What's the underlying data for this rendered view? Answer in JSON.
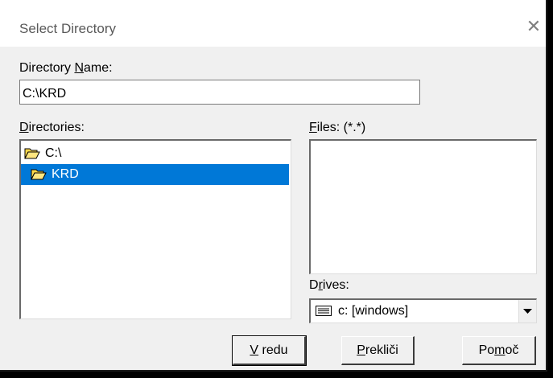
{
  "window": {
    "title": "Select Directory",
    "close_glyph": "✕"
  },
  "directory_name": {
    "label_pre": "Directory ",
    "label_u": "N",
    "label_post": "ame:",
    "value": "C:\\KRD"
  },
  "directories": {
    "label_u": "D",
    "label_post": "irectories:",
    "items": [
      {
        "label": "C:\\",
        "icon": "open-folder-icon",
        "selected": false
      },
      {
        "label": "KRD",
        "icon": "open-folder-icon",
        "selected": true
      }
    ]
  },
  "files": {
    "label_u": "F",
    "label_post": "iles: (*.*)",
    "items": []
  },
  "drives": {
    "label_pre": "D",
    "label_u": "r",
    "label_post": "ives:",
    "value": "c: [windows]",
    "icon": "drive-icon"
  },
  "buttons": {
    "ok": {
      "u": "V",
      "rest": " redu"
    },
    "cancel": {
      "u": "P",
      "rest": "rekliči"
    },
    "help": {
      "pre": "Po",
      "u": "m",
      "post": "oč"
    }
  },
  "colors": {
    "selection": "#0078d7",
    "folder": "#ffd94a"
  }
}
